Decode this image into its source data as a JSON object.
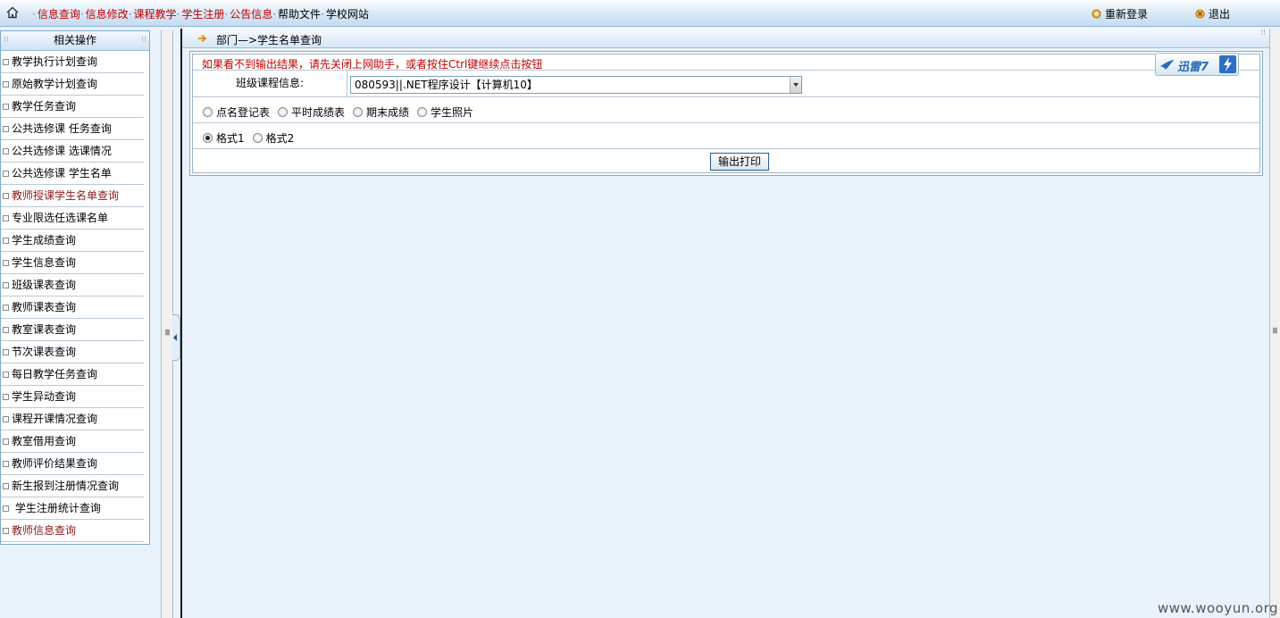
{
  "top_nav": {
    "items": [
      {
        "label": "信息查询",
        "color": "#c00000"
      },
      {
        "label": "信息修改",
        "color": "#c00000"
      },
      {
        "label": "课程教学",
        "color": "#c00000"
      },
      {
        "label": "学生注册",
        "color": "#c00000"
      },
      {
        "label": "公告信息",
        "color": "#c00000"
      },
      {
        "label": "帮助文件",
        "color": "#000000"
      },
      {
        "label": "学校网站",
        "color": "#000000"
      }
    ],
    "relogin_label": "重新登录",
    "logout_label": "退出"
  },
  "sidebar": {
    "title": "相关操作",
    "items": [
      {
        "label": "教学执行计划查询",
        "active": false
      },
      {
        "label": "原始教学计划查询",
        "active": false
      },
      {
        "label": "教学任务查询",
        "active": false
      },
      {
        "label": "公共选修课 任务查询",
        "active": false
      },
      {
        "label": "公共选修课 选课情况",
        "active": false
      },
      {
        "label": "公共选修课 学生名单",
        "active": false
      },
      {
        "label": "教师授课学生名单查询",
        "active": true
      },
      {
        "label": "专业限选任选课名单",
        "active": false
      },
      {
        "label": "学生成绩查询",
        "active": false
      },
      {
        "label": "学生信息查询",
        "active": false
      },
      {
        "label": "班级课表查询",
        "active": false
      },
      {
        "label": "教师课表查询",
        "active": false
      },
      {
        "label": "教室课表查询",
        "active": false
      },
      {
        "label": "节次课表查询",
        "active": false
      },
      {
        "label": "每日教学任务查询",
        "active": false
      },
      {
        "label": "学生异动查询",
        "active": false
      },
      {
        "label": "课程开课情况查询",
        "active": false
      },
      {
        "label": "教室借用查询",
        "active": false
      },
      {
        "label": "教师评价结果查询",
        "active": false
      },
      {
        "label": "新生报到注册情况查询",
        "active": false
      },
      {
        "label": " 学生注册统计查询",
        "active": false
      },
      {
        "label": "教师信息查询",
        "active": true
      }
    ]
  },
  "main": {
    "breadcrumb": "部门—>学生名单查询",
    "warning": "如果看不到输出结果，请先关闭上网助手，或者按住Ctrl键继续点击按钮",
    "class_field": {
      "label": "班级课程信息:",
      "value": "080593||.NET程序设计【计算机10】"
    },
    "report_types": [
      {
        "label": "点名登记表",
        "checked": false
      },
      {
        "label": "平时成绩表",
        "checked": false
      },
      {
        "label": "期末成绩",
        "checked": false
      },
      {
        "label": "学生照片",
        "checked": false
      }
    ],
    "formats": [
      {
        "label": "格式1",
        "checked": true
      },
      {
        "label": "格式2",
        "checked": false
      }
    ],
    "print_button": "输出打印"
  },
  "xunlei_badge": {
    "name": "迅雷7"
  },
  "watermark": "www.wooyun.org",
  "colors": {
    "accent_red": "#c00000",
    "active_item": "#8b1a1a",
    "panel_bg": "#eaf3fb",
    "border_blue": "#7eaad0"
  }
}
